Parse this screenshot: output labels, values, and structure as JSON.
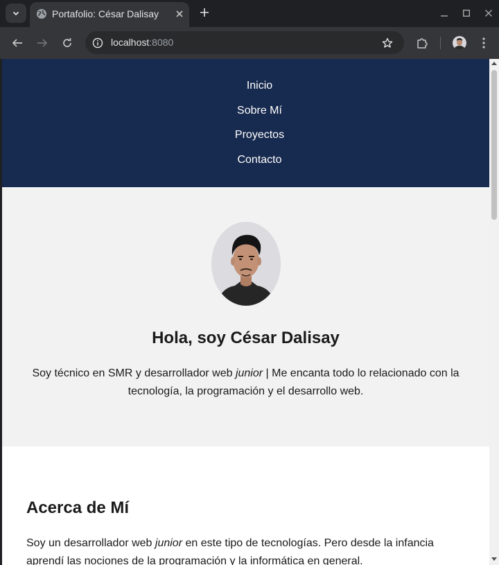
{
  "browser": {
    "tab": {
      "title": "Portafolio: César Dalisay",
      "close_icon": "close-icon"
    },
    "url": {
      "host": "localhost",
      "port": ":8080"
    },
    "colors": {
      "titlebar": "#1f2023",
      "toolbar": "#35363a",
      "omnibox": "#282a2c"
    }
  },
  "site": {
    "nav": {
      "items": [
        {
          "label": "Inicio"
        },
        {
          "label": "Sobre Mí"
        },
        {
          "label": "Proyectos"
        },
        {
          "label": "Contacto"
        }
      ]
    },
    "hero": {
      "heading": "Hola, soy César Dalisay",
      "intro_before": "Soy técnico en SMR y desarrollador web ",
      "intro_em": "junior",
      "intro_after": " | Me encanta todo lo relacionado con la tecnología, la programación y el desarrollo web."
    },
    "about": {
      "heading": "Acerca de Mí",
      "text_before": "Soy un desarrollador web ",
      "text_em": "junior",
      "text_after": " en este tipo de tecnologías. Pero desde la infancia aprendí las nociones de la programación y la informática en general."
    },
    "colors": {
      "nav_bg": "#172a4f",
      "hero_bg": "#f2f2f2",
      "text": "#1a1a1a"
    }
  }
}
